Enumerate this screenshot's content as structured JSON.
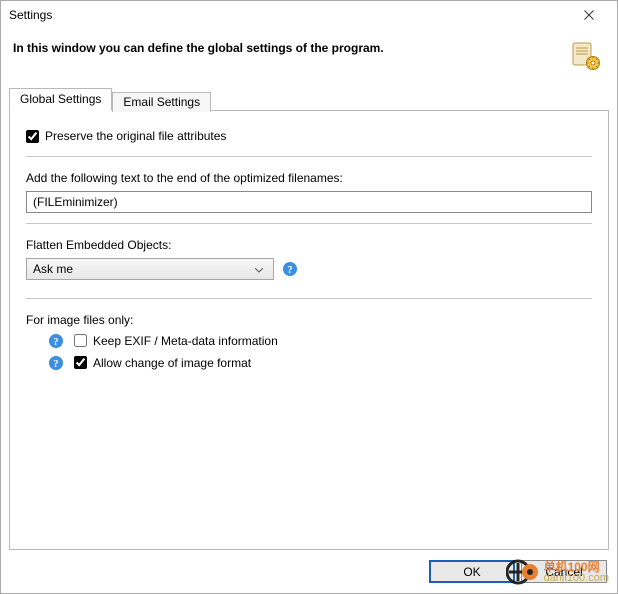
{
  "window": {
    "title": "Settings"
  },
  "header": {
    "text": "In this window you can define the global settings of the program."
  },
  "tabs": [
    {
      "label": "Global Settings",
      "active": true
    },
    {
      "label": "Email Settings",
      "active": false
    }
  ],
  "global_settings": {
    "preserve_attributes": {
      "label": "Preserve the original file attributes",
      "checked": true
    },
    "suffix": {
      "label": "Add the following text to the end of the optimized filenames:",
      "value": "(FILEminimizer)"
    },
    "flatten": {
      "label": "Flatten Embedded Objects:",
      "selected": "Ask me"
    },
    "image_section": {
      "heading": "For image files only:",
      "keep_exif": {
        "label": "Keep EXIF / Meta-data information",
        "checked": false
      },
      "allow_change": {
        "label": "Allow change of image format",
        "checked": true
      }
    }
  },
  "footer": {
    "ok": "OK",
    "cancel": "Cancel"
  },
  "watermark": {
    "line1": "单机100网",
    "line2": "danji100.com"
  }
}
